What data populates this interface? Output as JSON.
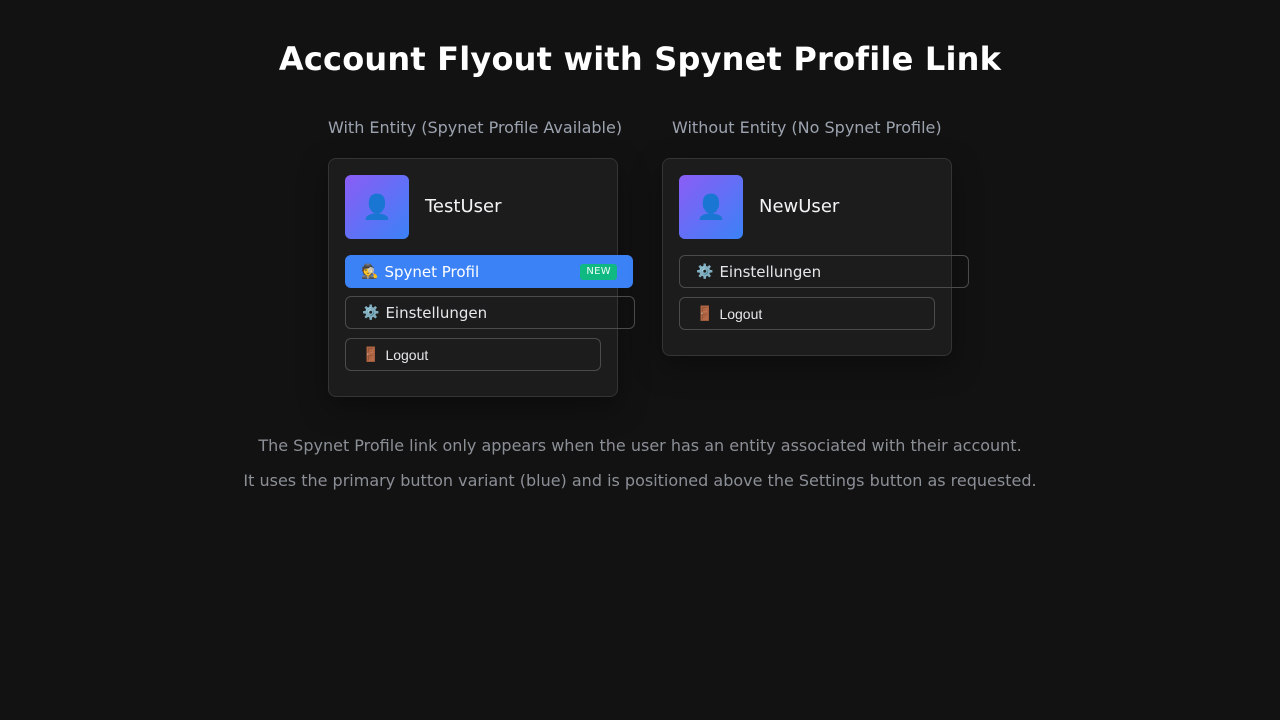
{
  "page": {
    "title": "Account Flyout with Spynet Profile Link"
  },
  "variants": [
    {
      "label": "With Entity (Spynet Profile Available)",
      "username": "TestUser",
      "avatar_icon": "user-icon",
      "buttons": {
        "spynet": {
          "icon": "🕵️",
          "label": "Spynet Profil",
          "badge": "NEW"
        },
        "settings": {
          "icon": "⚙️",
          "label": "Einstellungen"
        },
        "logout": {
          "icon": "🚪",
          "label": "Logout"
        }
      }
    },
    {
      "label": "Without Entity (No Spynet Profile)",
      "username": "NewUser",
      "avatar_icon": "user-icon",
      "buttons": {
        "settings": {
          "icon": "⚙️",
          "label": "Einstellungen"
        },
        "logout": {
          "icon": "🚪",
          "label": "Logout"
        }
      }
    }
  ],
  "notes": [
    "The Spynet Profile link only appears when the user has an entity associated with their account.",
    "It uses the primary button variant (blue) and is positioned above the Settings button as requested."
  ],
  "colors": {
    "primary": "#3b82f6",
    "badge": "#10b981",
    "avatar_gradient_start": "#8b5cf6",
    "avatar_gradient_end": "#3b82f6",
    "background": "#121212"
  }
}
